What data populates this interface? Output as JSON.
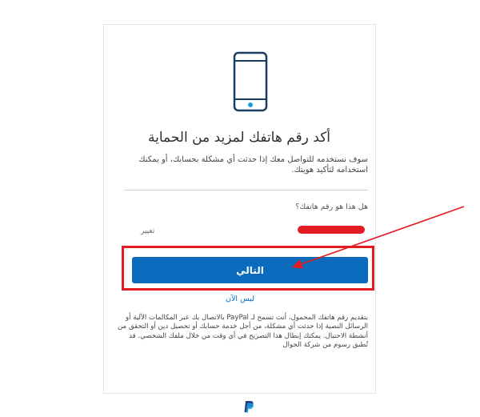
{
  "title": "أكد رقم هاتفك لمزيد من الحماية",
  "description": "سوف نستخدمه للتواصل معك إذا حدثت أي مشكلة بحسابك، أو يمكنك استخدامه لتأكيد هويتك.",
  "phone_question": "هل هذا هو رقم هاتفك؟",
  "change_label": "تغيير",
  "next_button_label": "التالي",
  "not_now_label": "ليس الآن",
  "legal_text": "بتقديم رقم هاتفك المحمول، أنت تسمح لـ PayPal بالاتصال بك عبر المكالمات الآلية أو الرسائل النصية إذا حدثت أي مشكلة، من أجل خدمة حسابك أو تحصيل دين أو التحقق من أنشطة الاحتيال. يمكنك إبطال هذا التصريح في أي وقت من خلال ملفك الشخصي. قد تُطبق رسوم من شركة الجوال",
  "colors": {
    "brand_blue": "#0a6bbd",
    "annotation_red": "#e31b23"
  },
  "icons": [
    "phone-icon",
    "paypal-logo-icon"
  ]
}
